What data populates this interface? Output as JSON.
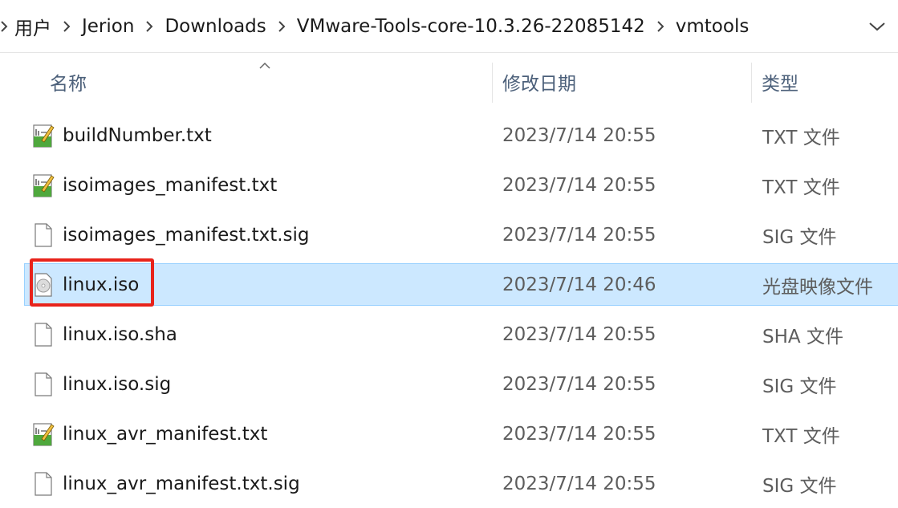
{
  "breadcrumb": {
    "items": [
      "用户",
      "Jerion",
      "Downloads",
      "VMware-Tools-core-10.3.26-22085142",
      "vmtools"
    ]
  },
  "columns": {
    "name": "名称",
    "date_modified": "修改日期",
    "type": "类型",
    "sort_indicator": "ascending"
  },
  "files": [
    {
      "name": "buildNumber.txt",
      "date": "2023/7/14 20:55",
      "type": "TXT 文件",
      "icon": "text-file-icon",
      "selected": false
    },
    {
      "name": "isoimages_manifest.txt",
      "date": "2023/7/14 20:55",
      "type": "TXT 文件",
      "icon": "text-file-icon",
      "selected": false
    },
    {
      "name": "isoimages_manifest.txt.sig",
      "date": "2023/7/14 20:55",
      "type": "SIG 文件",
      "icon": "blank-file-icon",
      "selected": false
    },
    {
      "name": "linux.iso",
      "date": "2023/7/14 20:46",
      "type": "光盘映像文件",
      "icon": "disc-image-icon",
      "selected": true
    },
    {
      "name": "linux.iso.sha",
      "date": "2023/7/14 20:55",
      "type": "SHA 文件",
      "icon": "blank-file-icon",
      "selected": false
    },
    {
      "name": "linux.iso.sig",
      "date": "2023/7/14 20:55",
      "type": "SIG 文件",
      "icon": "blank-file-icon",
      "selected": false
    },
    {
      "name": "linux_avr_manifest.txt",
      "date": "2023/7/14 20:55",
      "type": "TXT 文件",
      "icon": "text-file-icon",
      "selected": false
    },
    {
      "name": "linux_avr_manifest.txt.sig",
      "date": "2023/7/14 20:55",
      "type": "SIG 文件",
      "icon": "blank-file-icon",
      "selected": false
    }
  ],
  "colors": {
    "selection_bg": "#cce8ff",
    "selection_border": "#99d1ff",
    "annotation_red": "#e8231b",
    "header_text": "#4c607a"
  }
}
